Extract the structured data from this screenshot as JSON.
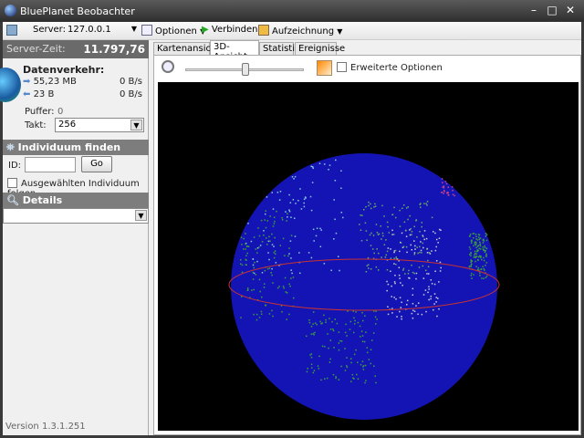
{
  "window": {
    "title": "BluePlanet Beobachter"
  },
  "toolbar": {
    "server_label": "Server:",
    "server_value": "127.0.0.1",
    "options": "Optionen",
    "connect": "Verbinden",
    "record": "Aufzeichnung"
  },
  "status": {
    "server_time_label": "Server-Zeit:",
    "server_time": "11.797,76"
  },
  "traffic": {
    "title": "Datenverkehr:",
    "sent_total": "55,23 MB",
    "sent_rate": "0 B/s",
    "recv_total": "23 B",
    "recv_rate": "0 B/s",
    "buffer_label": "Puffer:",
    "buffer_value": "0",
    "tick_label": "Takt:",
    "tick_value": "256"
  },
  "find": {
    "title": "Individuum finden",
    "id_label": "ID:",
    "id_value": "",
    "go": "Go",
    "follow": "Ausgewählten Individuum folgen",
    "follow_checked": false
  },
  "details": {
    "title": "Details",
    "value": ""
  },
  "version": "Version 1.3.1.251",
  "tabs": [
    {
      "label": "Kartenansicht"
    },
    {
      "label": "3D-Ansicht",
      "active": true
    },
    {
      "label": "Statistik"
    },
    {
      "label": "Ereignisse"
    }
  ],
  "view3d": {
    "zoom_level": 0.5,
    "advanced_label": "Erweiterte Optionen",
    "advanced_checked": false
  },
  "colors": {
    "globe": "#1414b4",
    "equator": "#c83232",
    "land": "#3ca03c",
    "header": "#7d7d7d"
  }
}
